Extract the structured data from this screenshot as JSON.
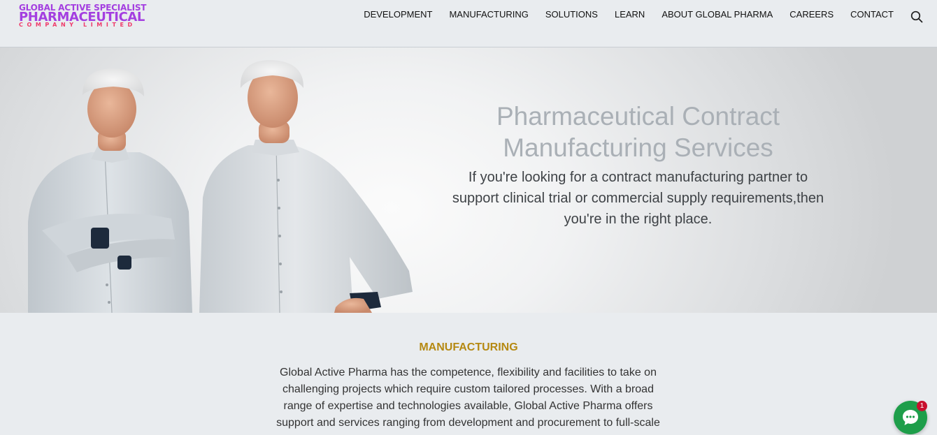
{
  "brand": {
    "line1": "GLOBAL ACTIVE SPECIALIST",
    "line2": "PHARMACEUTICAL",
    "line3": "COMPANY LIMITED"
  },
  "nav": {
    "items": [
      {
        "label": "DEVELOPMENT"
      },
      {
        "label": "MANUFACTURING"
      },
      {
        "label": "SOLUTIONS"
      },
      {
        "label": "LEARN"
      },
      {
        "label": "ABOUT GLOBAL PHARMA"
      },
      {
        "label": "CAREERS"
      },
      {
        "label": "CONTACT"
      }
    ],
    "search_icon": "search-icon"
  },
  "hero": {
    "title_line1": "Pharmaceutical Contract",
    "title_line2": "Manufacturing Services",
    "text_line1": "If you're looking for a contract manufacturing partner to",
    "text_line2": "support clinical trial or commercial supply requirements,then",
    "text_line3": "you're in the right place."
  },
  "section": {
    "heading": "MANUFACTURING",
    "lines": [
      "Global Active Pharma has the competence, flexibility and facilities to take on",
      "challenging projects which require custom tailored processes. With a broad",
      "range of expertise and technologies available, Global Active Pharma offers",
      "support and services ranging from development and procurement to full-scale"
    ]
  },
  "chat": {
    "badge_count": "1",
    "icon": "chat-bubble-icon"
  },
  "colors": {
    "brand_purple": "#a43fe0",
    "brand_pink": "#ef3b6a",
    "heading_gold": "#b58912",
    "chat_green": "#1e9e4a"
  }
}
